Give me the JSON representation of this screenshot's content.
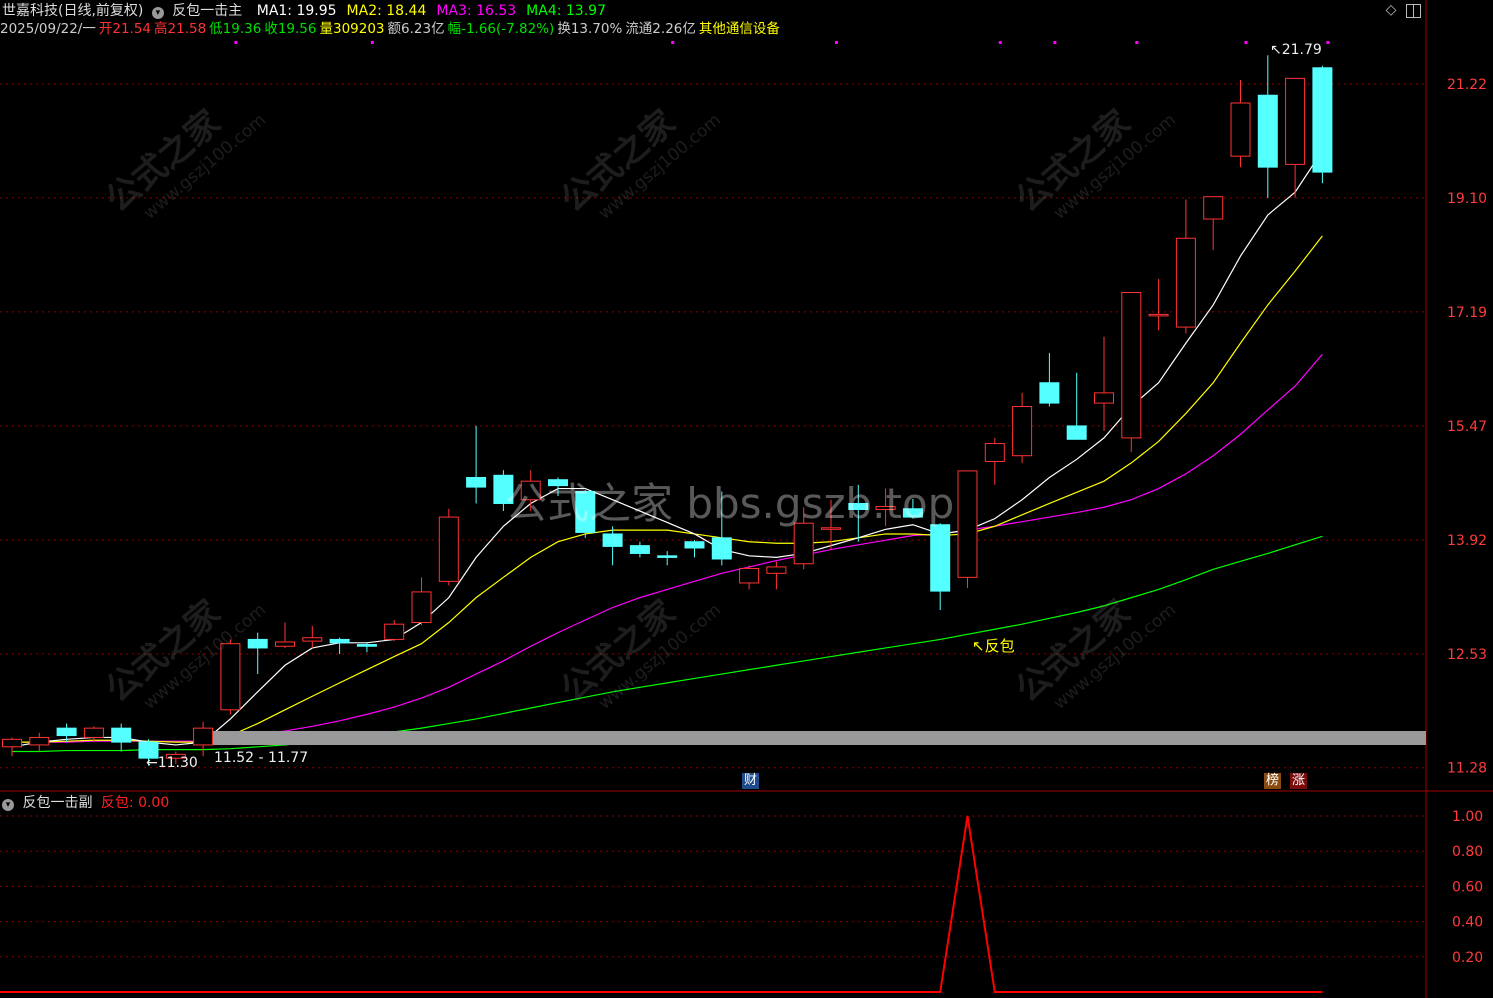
{
  "header": {
    "stock_name": "世嘉科技(日线,前复权)",
    "indicator_name": "反包一击主",
    "ma": [
      {
        "label": "MA1: 19.95",
        "color": "#ffffff"
      },
      {
        "label": "MA2: 18.44",
        "color": "#ffff00"
      },
      {
        "label": "MA3: 16.53",
        "color": "#ff00ff"
      },
      {
        "label": "MA4: 13.97",
        "color": "#00ff00"
      }
    ],
    "quote": [
      {
        "text": "2025/09/22/一",
        "color": "#cccccc"
      },
      {
        "text": "开21.54",
        "color": "#ff3333"
      },
      {
        "text": "高21.58",
        "color": "#ff3333"
      },
      {
        "text": "低19.36",
        "color": "#00e000"
      },
      {
        "text": "收19.56",
        "color": "#00e000"
      },
      {
        "text": "量309203",
        "color": "#ffff00"
      },
      {
        "text": "额6.23亿",
        "color": "#cccccc"
      },
      {
        "text": "幅-1.66(-7.82%)",
        "color": "#00e000"
      },
      {
        "text": "换13.70%",
        "color": "#cccccc"
      },
      {
        "text": "流通2.26亿",
        "color": "#cccccc"
      },
      {
        "text": "其他通信设备",
        "color": "#ffff00"
      }
    ]
  },
  "price_axis": [
    "21.22",
    "19.10",
    "17.19",
    "15.47",
    "13.92",
    "12.53",
    "11.28"
  ],
  "annotations": {
    "high_label": "21.79",
    "low_label": "11.30",
    "band_label": "11.52 - 11.77",
    "fanbao_label": "反包",
    "cai_badge": "财",
    "bang_badge": "榜",
    "zhang_badge": "涨"
  },
  "sub_panel": {
    "title": "反包一击副",
    "value_label": "反包: 0.00",
    "axis": [
      "1.00",
      "0.80",
      "0.60",
      "0.40",
      "0.20"
    ]
  },
  "watermark": {
    "center": "公式之家 bbs.gszb.top",
    "diag": "公式之家",
    "diag_url": "www.gszj100.com"
  },
  "colors": {
    "up": "#ff3333",
    "down": "#54ffff",
    "ma1": "#ffffff",
    "ma2": "#ffff00",
    "ma3": "#ff00ff",
    "ma4": "#00ff00",
    "grid": "#8b0000",
    "signal": "#ff0000"
  },
  "chart_data": {
    "type": "candlestick",
    "candles": [
      {
        "o": 11.5,
        "h": 11.6,
        "l": 11.4,
        "c": 11.58
      },
      {
        "o": 11.52,
        "h": 11.65,
        "l": 11.45,
        "c": 11.6
      },
      {
        "o": 11.7,
        "h": 11.75,
        "l": 11.55,
        "c": 11.62
      },
      {
        "o": 11.6,
        "h": 11.72,
        "l": 11.55,
        "c": 11.7
      },
      {
        "o": 11.7,
        "h": 11.75,
        "l": 11.45,
        "c": 11.55
      },
      {
        "o": 11.55,
        "h": 11.58,
        "l": 11.3,
        "c": 11.38
      },
      {
        "o": 11.38,
        "h": 11.45,
        "l": 11.32,
        "c": 11.42
      },
      {
        "o": 11.52,
        "h": 11.77,
        "l": 11.4,
        "c": 11.7
      },
      {
        "o": 11.9,
        "h": 12.7,
        "l": 11.85,
        "c": 12.65
      },
      {
        "o": 12.7,
        "h": 12.78,
        "l": 12.3,
        "c": 12.6
      },
      {
        "o": 12.62,
        "h": 12.9,
        "l": 12.6,
        "c": 12.67
      },
      {
        "o": 12.68,
        "h": 12.86,
        "l": 12.6,
        "c": 12.72
      },
      {
        "o": 12.7,
        "h": 12.72,
        "l": 12.53,
        "c": 12.66
      },
      {
        "o": 12.64,
        "h": 12.66,
        "l": 12.55,
        "c": 12.62
      },
      {
        "o": 12.7,
        "h": 12.93,
        "l": 12.68,
        "c": 12.88
      },
      {
        "o": 12.9,
        "h": 13.45,
        "l": 12.87,
        "c": 13.27
      },
      {
        "o": 13.4,
        "h": 14.33,
        "l": 13.35,
        "c": 14.22
      },
      {
        "o": 14.75,
        "h": 15.47,
        "l": 14.4,
        "c": 14.62
      },
      {
        "o": 14.78,
        "h": 14.85,
        "l": 14.3,
        "c": 14.4
      },
      {
        "o": 14.45,
        "h": 14.85,
        "l": 14.3,
        "c": 14.7
      },
      {
        "o": 14.72,
        "h": 14.75,
        "l": 14.5,
        "c": 14.64
      },
      {
        "o": 14.56,
        "h": 14.58,
        "l": 13.95,
        "c": 14.02
      },
      {
        "o": 14.0,
        "h": 14.1,
        "l": 13.6,
        "c": 13.84
      },
      {
        "o": 13.85,
        "h": 13.9,
        "l": 13.7,
        "c": 13.75
      },
      {
        "o": 13.72,
        "h": 13.78,
        "l": 13.6,
        "c": 13.7
      },
      {
        "o": 13.9,
        "h": 13.92,
        "l": 13.7,
        "c": 13.82
      },
      {
        "o": 13.95,
        "h": 14.56,
        "l": 13.6,
        "c": 13.68
      },
      {
        "o": 13.38,
        "h": 13.6,
        "l": 13.3,
        "c": 13.56
      },
      {
        "o": 13.5,
        "h": 13.65,
        "l": 13.3,
        "c": 13.58
      },
      {
        "o": 13.62,
        "h": 14.35,
        "l": 13.55,
        "c": 14.14
      },
      {
        "o": 14.07,
        "h": 14.45,
        "l": 13.8,
        "c": 14.08
      },
      {
        "o": 14.4,
        "h": 14.65,
        "l": 13.9,
        "c": 14.32
      },
      {
        "o": 14.32,
        "h": 14.6,
        "l": 14.1,
        "c": 14.36
      },
      {
        "o": 14.33,
        "h": 14.46,
        "l": 14.2,
        "c": 14.22
      },
      {
        "o": 14.12,
        "h": 14.14,
        "l": 13.05,
        "c": 13.28
      },
      {
        "o": 13.45,
        "h": 14.82,
        "l": 13.32,
        "c": 14.84
      },
      {
        "o": 14.97,
        "h": 15.3,
        "l": 14.65,
        "c": 15.22
      },
      {
        "o": 15.05,
        "h": 15.95,
        "l": 14.95,
        "c": 15.75
      },
      {
        "o": 16.1,
        "h": 16.55,
        "l": 15.75,
        "c": 15.8
      },
      {
        "o": 15.47,
        "h": 16.25,
        "l": 15.35,
        "c": 15.28
      },
      {
        "o": 15.8,
        "h": 16.8,
        "l": 15.4,
        "c": 15.95
      },
      {
        "o": 15.3,
        "h": 17.5,
        "l": 15.1,
        "c": 17.5
      },
      {
        "o": 17.15,
        "h": 17.72,
        "l": 16.9,
        "c": 17.15
      },
      {
        "o": 16.95,
        "h": 19.07,
        "l": 16.85,
        "c": 18.4
      },
      {
        "o": 18.73,
        "h": 19.07,
        "l": 18.2,
        "c": 19.12
      },
      {
        "o": 19.85,
        "h": 21.3,
        "l": 19.65,
        "c": 20.85
      },
      {
        "o": 21.0,
        "h": 21.79,
        "l": 19.1,
        "c": 19.65
      },
      {
        "o": 19.7,
        "h": 21.3,
        "l": 19.1,
        "c": 21.33
      },
      {
        "o": 21.54,
        "h": 21.58,
        "l": 19.36,
        "c": 19.56
      }
    ],
    "ma1": [
      11.5,
      11.55,
      11.58,
      11.6,
      11.6,
      11.55,
      11.52,
      11.55,
      11.8,
      12.1,
      12.4,
      12.6,
      12.66,
      12.66,
      12.7,
      12.9,
      13.2,
      13.7,
      14.1,
      14.4,
      14.6,
      14.6,
      14.45,
      14.3,
      14.15,
      14.0,
      13.8,
      13.72,
      13.7,
      13.75,
      13.85,
      13.95,
      14.06,
      14.12,
      14.0,
      14.05,
      14.2,
      14.45,
      14.75,
      15.0,
      15.3,
      15.75,
      16.1,
      16.7,
      17.3,
      18.1,
      18.8,
      19.2,
      19.95
    ],
    "ma2": [
      11.55,
      11.55,
      11.56,
      11.57,
      11.57,
      11.56,
      11.55,
      11.55,
      11.62,
      11.75,
      11.9,
      12.05,
      12.2,
      12.35,
      12.5,
      12.65,
      12.9,
      13.2,
      13.45,
      13.7,
      13.9,
      14.0,
      14.05,
      14.05,
      14.05,
      14.0,
      13.95,
      13.9,
      13.88,
      13.88,
      13.9,
      13.95,
      14.0,
      14.0,
      13.98,
      14.0,
      14.1,
      14.25,
      14.4,
      14.55,
      14.7,
      14.95,
      15.25,
      15.65,
      16.1,
      16.7,
      17.3,
      17.85,
      18.44
    ],
    "ma3": [
      11.55,
      11.55,
      11.55,
      11.56,
      11.56,
      11.56,
      11.56,
      11.56,
      11.58,
      11.62,
      11.67,
      11.72,
      11.78,
      11.85,
      11.93,
      12.03,
      12.15,
      12.3,
      12.45,
      12.62,
      12.78,
      12.93,
      13.08,
      13.2,
      13.3,
      13.4,
      13.5,
      13.58,
      13.66,
      13.73,
      13.8,
      13.86,
      13.92,
      13.98,
      14.0,
      14.05,
      14.1,
      14.16,
      14.22,
      14.28,
      14.35,
      14.45,
      14.6,
      14.8,
      15.05,
      15.35,
      15.7,
      16.05,
      16.53
    ],
    "ma4": [
      11.45,
      11.45,
      11.46,
      11.46,
      11.46,
      11.47,
      11.47,
      11.47,
      11.48,
      11.5,
      11.52,
      11.55,
      11.58,
      11.62,
      11.66,
      11.7,
      11.75,
      11.8,
      11.86,
      11.92,
      11.98,
      12.04,
      12.1,
      12.15,
      12.2,
      12.25,
      12.3,
      12.35,
      12.4,
      12.45,
      12.5,
      12.55,
      12.6,
      12.65,
      12.7,
      12.76,
      12.82,
      12.88,
      12.95,
      13.02,
      13.1,
      13.2,
      13.3,
      13.42,
      13.55,
      13.65,
      13.75,
      13.86,
      13.97
    ],
    "signal": [
      0,
      0,
      0,
      0,
      0,
      0,
      0,
      0,
      0,
      0,
      0,
      0,
      0,
      0,
      0,
      0,
      0,
      0,
      0,
      0,
      0,
      0,
      0,
      0,
      0,
      0,
      0,
      0,
      0,
      0,
      0,
      0,
      0,
      0,
      0,
      1,
      0,
      0,
      0,
      0,
      0,
      0,
      0,
      0,
      0,
      0,
      0,
      0,
      0
    ],
    "fanbao_index": 35,
    "ylim": [
      11.05,
      22.1
    ],
    "log_scale": true,
    "sub_ylim": [
      0,
      1.0
    ],
    "magenta_marker_indices": [
      8,
      13,
      24,
      30,
      36,
      38,
      41,
      45,
      48
    ]
  }
}
